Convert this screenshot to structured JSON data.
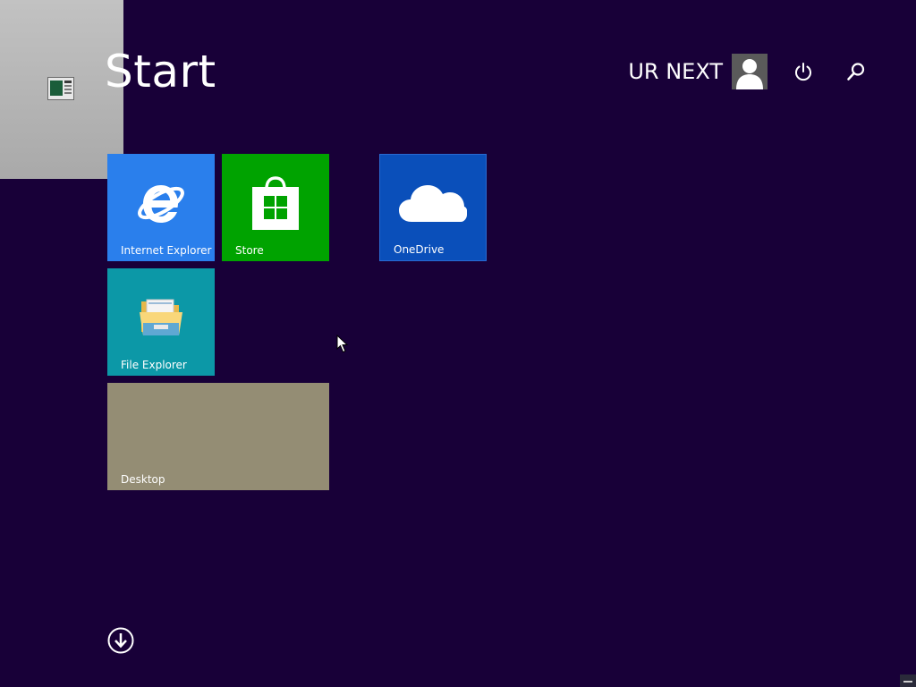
{
  "page": {
    "title": "Start",
    "background_color": "#180038"
  },
  "user": {
    "name": "UR NEXT",
    "avatar_icon": "user-silhouette-icon"
  },
  "header_buttons": {
    "power_icon": "power-icon",
    "search_icon": "search-icon"
  },
  "corner_preview": {
    "icon": "desktop-thumbnail-icon"
  },
  "tiles": [
    {
      "id": "internet-explorer",
      "label": "Internet Explorer",
      "color": "#2a7fec",
      "icon": "internet-explorer-icon"
    },
    {
      "id": "store",
      "label": "Store",
      "color": "#00a300",
      "icon": "store-bag-icon"
    },
    {
      "id": "onedrive",
      "label": "OneDrive",
      "color": "#0a4fba",
      "icon": "cloud-icon"
    },
    {
      "id": "file-explorer",
      "label": "File Explorer",
      "color": "#0c98a7",
      "icon": "folder-icon"
    },
    {
      "id": "desktop",
      "label": "Desktop",
      "color": "#948d74",
      "icon": ""
    }
  ],
  "footer": {
    "apps_view_icon": "down-arrow-circle-icon"
  }
}
